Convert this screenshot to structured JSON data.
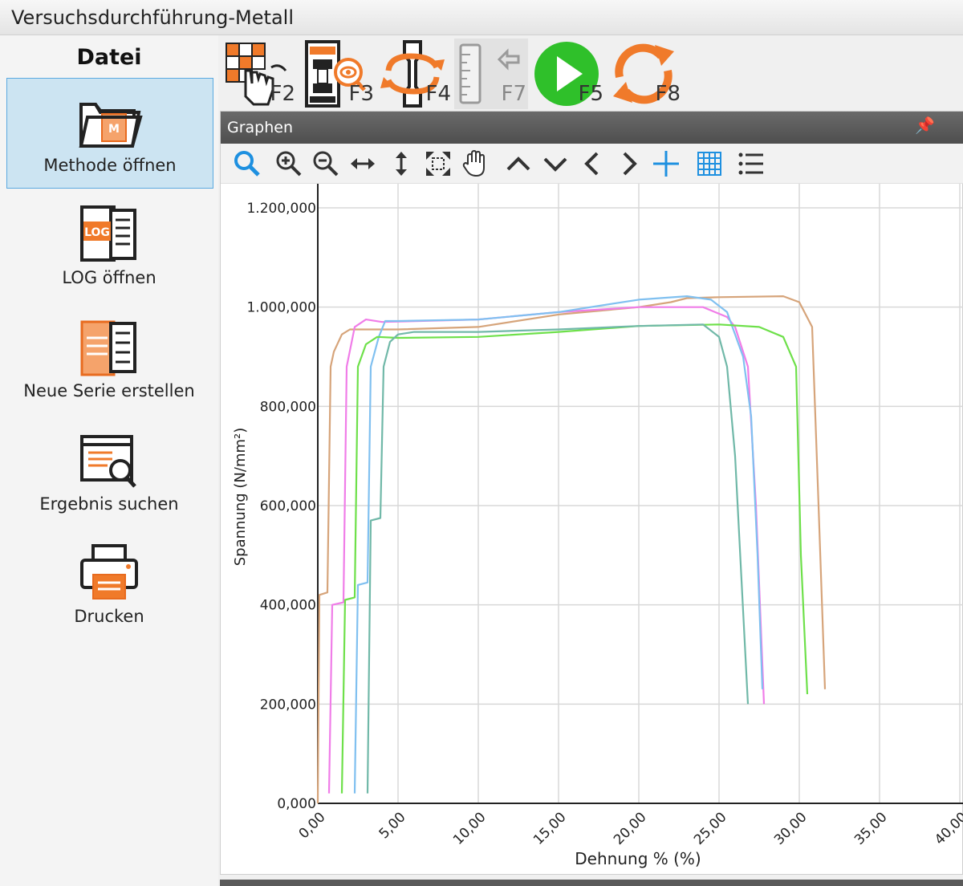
{
  "window": {
    "title": "Versuchsdurchführung-Metall"
  },
  "sidebar": {
    "header": "Datei",
    "items": [
      {
        "label": "Methode öffnen",
        "icon": "folder-method-icon",
        "active": true
      },
      {
        "label": "LOG öffnen",
        "icon": "log-file-icon",
        "active": false
      },
      {
        "label": "Neue Serie erstellen",
        "icon": "new-series-icon",
        "active": false
      },
      {
        "label": "Ergebnis suchen",
        "icon": "search-result-icon",
        "active": false
      },
      {
        "label": "Drucken",
        "icon": "printer-icon",
        "active": false
      }
    ]
  },
  "toolbar": {
    "buttons": [
      {
        "key": "F2",
        "icon": "grid-hand-icon"
      },
      {
        "key": "F3",
        "icon": "machine-view-icon"
      },
      {
        "key": "F4",
        "icon": "specimen-rotate-icon"
      },
      {
        "key": "F7",
        "icon": "ruler-return-icon",
        "disabled": true
      },
      {
        "key": "F5",
        "icon": "play-icon"
      },
      {
        "key": "F8",
        "icon": "refresh-icon"
      }
    ]
  },
  "panel": {
    "title": "Graphen",
    "pin": "📌",
    "tools": [
      "zoom-icon",
      "zoom-in-icon",
      "zoom-out-icon",
      "horizontal-fit-icon",
      "vertical-fit-icon",
      "fit-all-icon",
      "pan-hand-icon",
      "up-icon",
      "down-icon",
      "left-icon",
      "right-icon",
      "crosshair-icon",
      "grid-icon",
      "legend-icon"
    ]
  },
  "chart_data": {
    "type": "line",
    "xlabel": "Dehnung % (%)",
    "ylabel": "Spannung (N/mm²)",
    "xlim": [
      0,
      40
    ],
    "ylim": [
      0,
      1200
    ],
    "x_ticks": [
      "0,00",
      "5,00",
      "10,00",
      "15,00",
      "20,00",
      "25,00",
      "30,00",
      "35,00",
      "40,00"
    ],
    "y_ticks": [
      "0,000",
      "200,000",
      "400,000",
      "600,000",
      "800,000",
      "1.000,000",
      "1.200,000"
    ],
    "grid": true,
    "series": [
      {
        "color": "#d6a47a",
        "points": [
          [
            0,
            0
          ],
          [
            0.1,
            420
          ],
          [
            0.6,
            425
          ],
          [
            0.8,
            880
          ],
          [
            1,
            910
          ],
          [
            1.5,
            945
          ],
          [
            2,
            955
          ],
          [
            5,
            955
          ],
          [
            10,
            960
          ],
          [
            15,
            985
          ],
          [
            20,
            1000
          ],
          [
            22,
            1010
          ],
          [
            23,
            1018
          ],
          [
            25,
            1020
          ],
          [
            29,
            1022
          ],
          [
            30,
            1010
          ],
          [
            30.8,
            960
          ],
          [
            31.2,
            600
          ],
          [
            31.6,
            230
          ]
        ]
      },
      {
        "color": "#f07de8",
        "points": [
          [
            0.7,
            20
          ],
          [
            0.9,
            400
          ],
          [
            1.6,
            405
          ],
          [
            1.8,
            880
          ],
          [
            2.3,
            960
          ],
          [
            3,
            975
          ],
          [
            4,
            970
          ],
          [
            10,
            975
          ],
          [
            15,
            990
          ],
          [
            20,
            1000
          ],
          [
            24,
            1000
          ],
          [
            25.5,
            980
          ],
          [
            26,
            960
          ],
          [
            26.8,
            880
          ],
          [
            27.3,
            600
          ],
          [
            27.8,
            200
          ]
        ]
      },
      {
        "color": "#80c0f0",
        "points": [
          [
            2.3,
            20
          ],
          [
            2.5,
            440
          ],
          [
            3.1,
            445
          ],
          [
            3.3,
            880
          ],
          [
            3.8,
            940
          ],
          [
            4.2,
            972
          ],
          [
            5,
            972
          ],
          [
            10,
            975
          ],
          [
            15,
            990
          ],
          [
            20,
            1015
          ],
          [
            23,
            1022
          ],
          [
            24.5,
            1015
          ],
          [
            25.5,
            990
          ],
          [
            26.5,
            900
          ],
          [
            27,
            780
          ],
          [
            27.4,
            500
          ],
          [
            27.7,
            230
          ]
        ]
      },
      {
        "color": "#6ee04a",
        "points": [
          [
            1.5,
            20
          ],
          [
            1.7,
            410
          ],
          [
            2.3,
            415
          ],
          [
            2.5,
            880
          ],
          [
            3,
            925
          ],
          [
            3.7,
            940
          ],
          [
            5,
            938
          ],
          [
            10,
            940
          ],
          [
            15,
            950
          ],
          [
            20,
            962
          ],
          [
            25,
            965
          ],
          [
            27.5,
            960
          ],
          [
            29,
            940
          ],
          [
            29.8,
            880
          ],
          [
            30.1,
            500
          ],
          [
            30.5,
            220
          ]
        ]
      },
      {
        "color": "#70b8a8",
        "points": [
          [
            3.1,
            20
          ],
          [
            3.3,
            570
          ],
          [
            3.9,
            575
          ],
          [
            4.1,
            880
          ],
          [
            4.5,
            930
          ],
          [
            5,
            945
          ],
          [
            6,
            950
          ],
          [
            10,
            950
          ],
          [
            15,
            955
          ],
          [
            20,
            962
          ],
          [
            24,
            965
          ],
          [
            25,
            940
          ],
          [
            25.5,
            880
          ],
          [
            26,
            700
          ],
          [
            26.4,
            450
          ],
          [
            26.8,
            200
          ]
        ]
      }
    ]
  }
}
